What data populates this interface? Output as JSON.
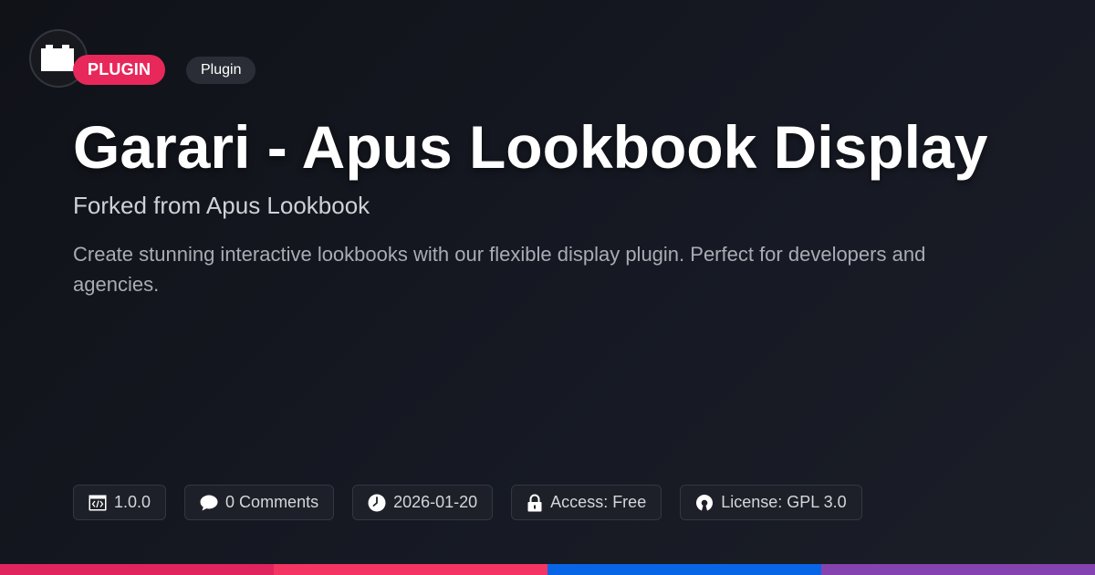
{
  "header": {
    "logo_icon": "plugin-block-icon",
    "badge_primary": "PLUGIN",
    "badge_secondary": "Plugin"
  },
  "title": "Garari - Apus Lookbook Display",
  "subtitle": "Forked from Apus Lookbook",
  "description": "Create stunning interactive lookbooks with our flexible display plugin. Perfect for developers and agencies.",
  "meta": [
    {
      "icon": "code-window-icon",
      "text": "1.0.0"
    },
    {
      "icon": "comment-bubble-icon",
      "text": "0 Comments"
    },
    {
      "icon": "clock-icon",
      "text": "2026-01-20"
    },
    {
      "icon": "lock-icon",
      "text": "Access: Free"
    },
    {
      "icon": "open-source-icon",
      "text": "License: GPL 3.0"
    }
  ],
  "colors": {
    "accent": "#e8285a",
    "bar": [
      "#e0245e",
      "#f43563",
      "#0866e6",
      "#8543b0"
    ]
  }
}
